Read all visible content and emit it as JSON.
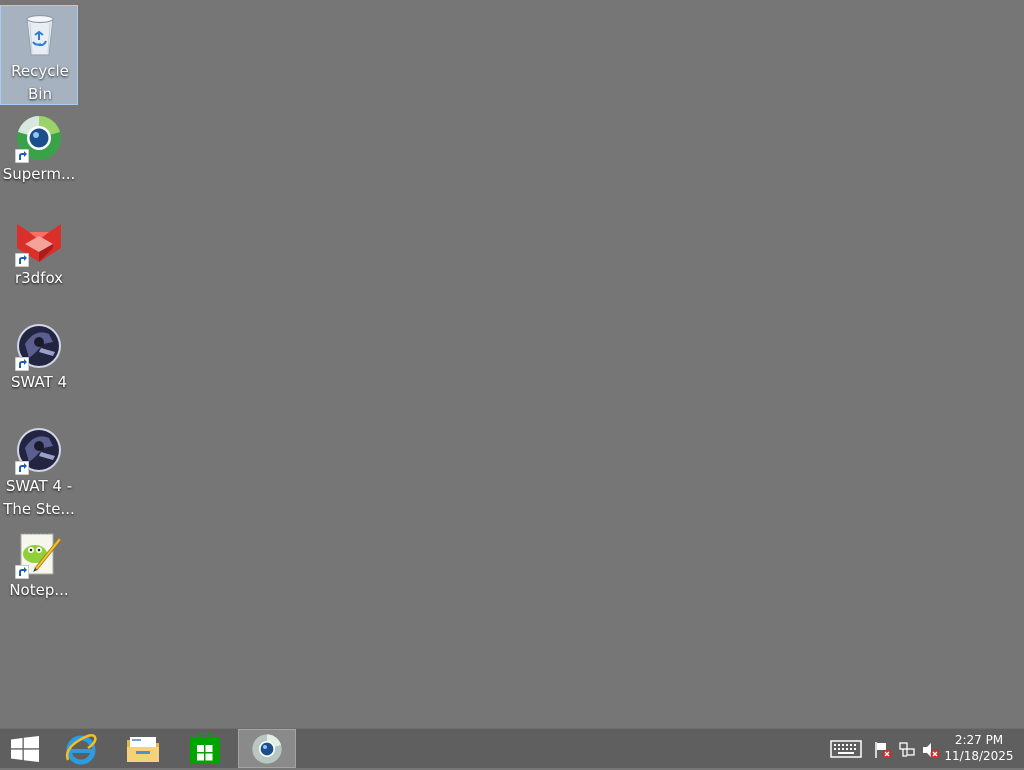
{
  "desktop": {
    "background_color": "#767676",
    "icons": [
      {
        "label": "Recycle\nBin",
        "icon": "recycle-bin-icon",
        "selected": true
      },
      {
        "label": "Superm...",
        "icon": "supermium-icon",
        "shortcut": true
      },
      {
        "label": "r3dfox",
        "icon": "r3dfox-icon",
        "shortcut": true
      },
      {
        "label": "SWAT 4",
        "icon": "swat4-icon",
        "shortcut": true
      },
      {
        "label": "SWAT 4 -\nThe Ste...",
        "icon": "swat4-stetchkov-icon",
        "shortcut": true
      },
      {
        "label": "Notep...",
        "icon": "notepad-plus-plus-icon",
        "shortcut": true
      }
    ]
  },
  "taskbar": {
    "pinned": [
      {
        "name": "start-button",
        "icon": "windows-logo-icon"
      },
      {
        "name": "internet-explorer",
        "icon": "internet-explorer-icon"
      },
      {
        "name": "file-explorer",
        "icon": "file-explorer-icon"
      },
      {
        "name": "store",
        "icon": "store-icon"
      },
      {
        "name": "supermium",
        "icon": "supermium-icon",
        "active": true
      }
    ],
    "tray": {
      "icons": [
        "touch-keyboard-icon",
        "action-center-flag-icon",
        "network-icon",
        "volume-muted-icon"
      ],
      "time": "2:27 PM",
      "date": "11/18/2025"
    }
  }
}
